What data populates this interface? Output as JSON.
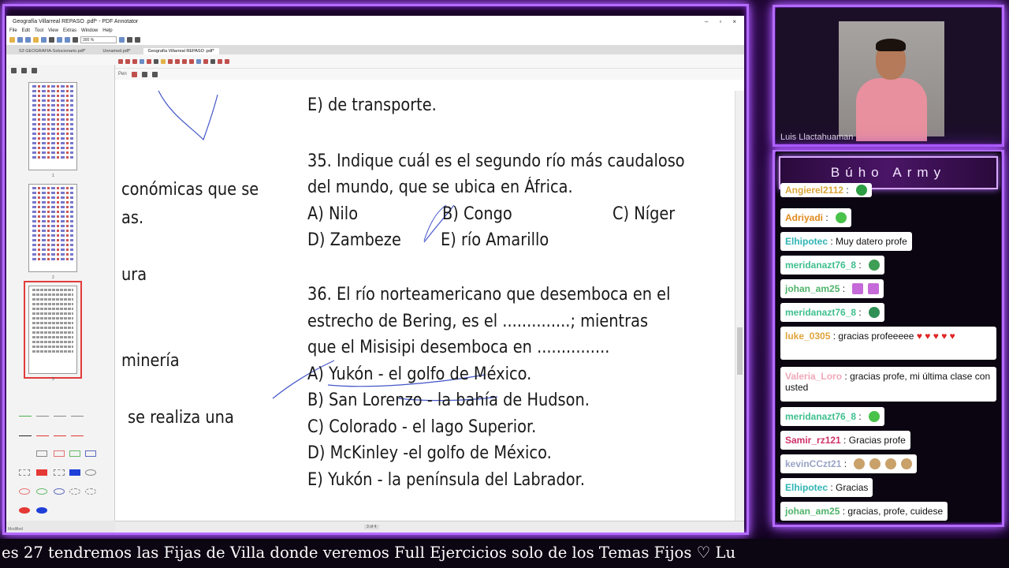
{
  "window": {
    "title": "Geografía Villarreal REPASO .pdf* - PDF Annotator",
    "menu": [
      "File",
      "Edit",
      "Tool",
      "View",
      "Extras",
      "Window",
      "Help"
    ],
    "zoom": "300 %"
  },
  "tabs": [
    {
      "label": "S3 GEOGRAFIA-Solucionario.pdf*",
      "active": false
    },
    {
      "label": "Unnamed.pdf*",
      "active": false
    },
    {
      "label": "Geografía Villarreal REPASO .pdf*",
      "active": true
    }
  ],
  "toolbar3": {
    "tool_label": "Pen"
  },
  "sidebar": {
    "pages": [
      "1",
      "2",
      "3"
    ],
    "status": "Modified"
  },
  "document": {
    "left_fragments": [
      "E) de transporte.",
      "conómicas que se",
      "as.",
      "ura",
      "minería",
      "se  realiza  una"
    ],
    "q35": {
      "stem1": "35. Indique cuál es el segundo río más caudaloso",
      "stem2": "del mundo, que se ubica en África.",
      "a": "A) Nilo",
      "b": "B) Congo",
      "c": "C) Níger",
      "d": "D) Zambeze",
      "e": "E) río Amarillo"
    },
    "q36": {
      "stem1": "36. El río norteamericano que desemboca en el",
      "stem2": "estrecho de Bering, es el ..............; mientras",
      "stem3": "que el Misisipi desemboca en ...............",
      "a": "A) Yukón - el golfo de México.",
      "b": "B) San Lorenzo - la bahía de Hudson.",
      "c": "C) Colorado - el lago Superior.",
      "d": "D) McKinley -el golfo de México.",
      "e": "E) Yukón - la península del Labrador."
    },
    "page_indicator": "3 of 4"
  },
  "webcam": {
    "name": "Luis Llactahuaman"
  },
  "chat": {
    "title": "Búho Army",
    "messages": [
      {
        "user": "Angierel2112",
        "text": "",
        "color": "#d9a43a",
        "emoji": "#2e9e44"
      },
      {
        "user": "Adriyadi",
        "text": "",
        "color": "#e08a1e",
        "emoji": "#49c24a"
      },
      {
        "user": "Elhipotec",
        "text": "Muy datero profe",
        "color": "#2fb4b4",
        "emoji": ""
      },
      {
        "user": "meridanazt76_8",
        "text": "",
        "color": "#3fbf8f",
        "emoji": "#3e9e55"
      },
      {
        "user": "johan_am25",
        "text": "",
        "color": "#4fb36a",
        "emoji": "#c56ad8"
      },
      {
        "user": "meridanazt76_8",
        "text": "",
        "color": "#3fbf8f",
        "emoji": "#2f8f55"
      },
      {
        "user": "luke_0305",
        "text": "gracias profeeeee",
        "color": "#e0a33a",
        "emoji": ""
      },
      {
        "user": "Valeria_Loro",
        "text": "gracias profe, mi última clase",
        "text2": "con usted",
        "color": "#f0a8b8",
        "emoji": ""
      },
      {
        "user": "meridanazt76_8",
        "text": "",
        "color": "#3fbf8f",
        "emoji": "#49c24a"
      },
      {
        "user": "Samir_rz121",
        "text": "Gracias profe",
        "color": "#d0306a",
        "emoji": ""
      },
      {
        "user": "kevinCCzt21",
        "text": "",
        "color": "#9aa3c4",
        "emoji": "#c9a16a"
      },
      {
        "user": "Elhipotec",
        "text": "Gracias",
        "color": "#2fb4b4",
        "emoji": ""
      },
      {
        "user": "johan_am25",
        "text": "gracias, profe, cuidese",
        "color": "#4fb36a",
        "emoji": ""
      }
    ]
  },
  "ticker": {
    "text": "es 27 tendremos las Fijas de Villa donde veremos Full Ejercicios solo de los Temas Fijos   ♡   Lu"
  }
}
